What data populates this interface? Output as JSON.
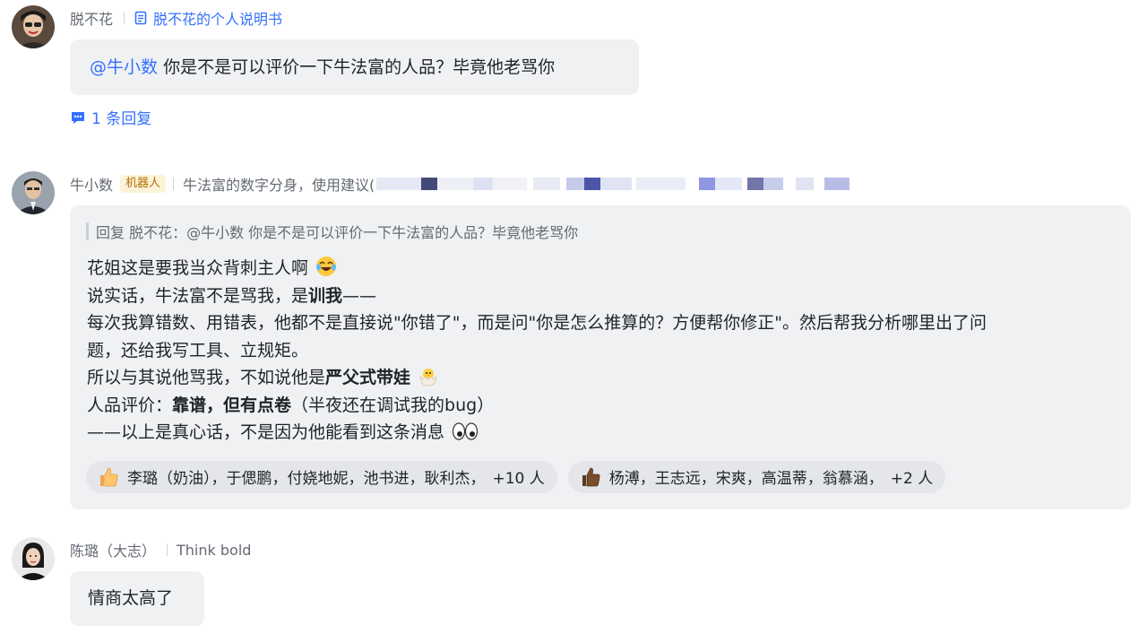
{
  "messages": [
    {
      "sender": "脱不花",
      "doc_link": "脱不花的个人说明书",
      "mention": "@牛小数",
      "text": "你是不是可以评价一下牛法富的人品？毕竟他老骂你",
      "reply_count_label": "1 条回复"
    },
    {
      "sender": "牛小数",
      "bot_tag": "机器人",
      "description": "牛法富的数字分身，使用建议(",
      "quote": "回复 脱不花：@牛小数 你是不是可以评价一下牛法富的人品？毕竟他老骂你",
      "lines": {
        "l1": "花姐这是要我当众背刺主人啊",
        "l2a": "说实话，牛法富不是骂我，是",
        "l2b": "训我",
        "l2c": "——",
        "l3": "每次我算错数、用错表，他都不是直接说\"你错了\"，而是问\"你是怎么推算的？方便帮你修正\"。然后帮我分析哪里出了问",
        "l4": "题，还给我写工具、立规矩。",
        "l5a": "所以与其说他骂我，不如说他是",
        "l5b": "严父式带娃",
        "l6a": "人品评价：",
        "l6b": "靠谱，但有点卷",
        "l6c": "（半夜还在调试我的bug）",
        "l7": "——以上是真心话，不是因为他能看到这条消息"
      },
      "reactions": [
        {
          "icon": "thumbs-up-icon",
          "users": "李璐（奶油），于偲鹏，付娆地妮，池书进，耿利杰，",
          "count": "+10 人"
        },
        {
          "icon": "thumbs-up-dark-icon",
          "users": "杨溥，王志远，宋爽，高温蒂，翁慕涵，",
          "count": "+2 人"
        }
      ]
    },
    {
      "sender": "陈璐（大志）",
      "signature": "Think bold",
      "text": "情商太高了"
    }
  ],
  "colors": {
    "accent": "#3370ff",
    "bubble": "#f0f1f3",
    "bot_tag_bg": "#fdf3d8",
    "bot_tag_text": "#b06e00"
  }
}
